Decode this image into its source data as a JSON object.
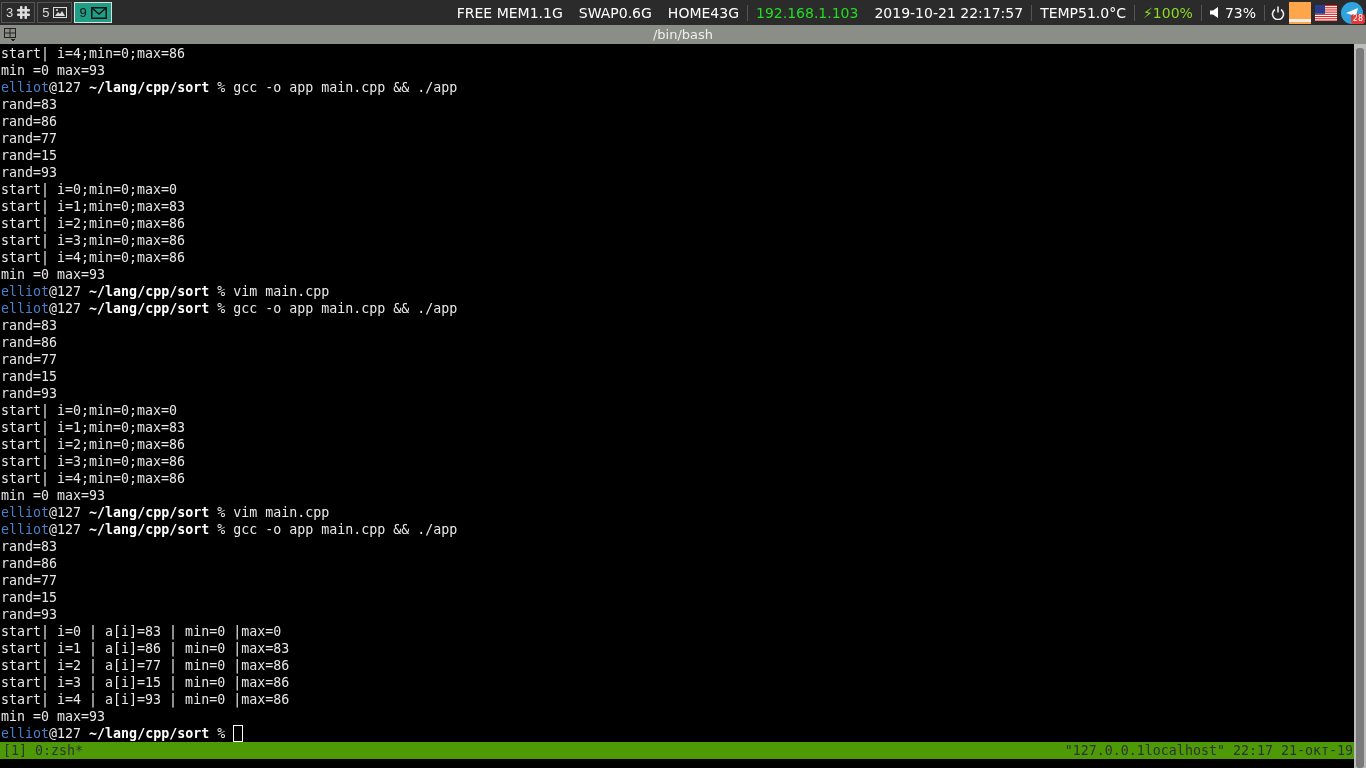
{
  "workspaces": [
    {
      "number": "3",
      "selected": false
    },
    {
      "number": "5",
      "selected": false
    },
    {
      "number": "9",
      "selected": true
    }
  ],
  "status": [
    {
      "kind": "text",
      "text": "FREE MEM1.1G",
      "color": "#ffffff"
    },
    {
      "kind": "text",
      "text": "SWAP0.6G",
      "color": "#ffffff"
    },
    {
      "kind": "text",
      "text": "HOME43G",
      "color": "#ffffff"
    },
    {
      "kind": "text",
      "text": "192.168.1.103",
      "color": "#22dd22"
    },
    {
      "kind": "text",
      "text": "2019-10-21 22:17:57",
      "color": "#ffffff"
    },
    {
      "kind": "text",
      "text": "TEMP51.0°C",
      "color": "#ffffff"
    },
    {
      "kind": "text",
      "text": "⚡100%",
      "color": "#88dd22"
    },
    {
      "kind": "volume",
      "text": "73%",
      "color": "#ffffff"
    }
  ],
  "tray": {
    "badge": "28"
  },
  "window": {
    "title": "/bin/bash"
  },
  "terminal": {
    "lines": [
      {
        "kind": "output",
        "text": "start| i=4;min=0;max=86"
      },
      {
        "kind": "output",
        "text": "min =0 max=93"
      },
      {
        "kind": "prompt",
        "user": "elliot",
        "host": "@127",
        "path": "~/lang/cpp/sort",
        "command": "% gcc -o app main.cpp && ./app"
      },
      {
        "kind": "output",
        "text": "rand=83"
      },
      {
        "kind": "output",
        "text": "rand=86"
      },
      {
        "kind": "output",
        "text": "rand=77"
      },
      {
        "kind": "output",
        "text": "rand=15"
      },
      {
        "kind": "output",
        "text": "rand=93"
      },
      {
        "kind": "output",
        "text": "start| i=0;min=0;max=0"
      },
      {
        "kind": "output",
        "text": "start| i=1;min=0;max=83"
      },
      {
        "kind": "output",
        "text": "start| i=2;min=0;max=86"
      },
      {
        "kind": "output",
        "text": "start| i=3;min=0;max=86"
      },
      {
        "kind": "output",
        "text": "start| i=4;min=0;max=86"
      },
      {
        "kind": "output",
        "text": "min =0 max=93"
      },
      {
        "kind": "prompt",
        "user": "elliot",
        "host": "@127",
        "path": "~/lang/cpp/sort",
        "command": "% vim main.cpp"
      },
      {
        "kind": "prompt",
        "user": "elliot",
        "host": "@127",
        "path": "~/lang/cpp/sort",
        "command": "% gcc -o app main.cpp && ./app"
      },
      {
        "kind": "output",
        "text": "rand=83"
      },
      {
        "kind": "output",
        "text": "rand=86"
      },
      {
        "kind": "output",
        "text": "rand=77"
      },
      {
        "kind": "output",
        "text": "rand=15"
      },
      {
        "kind": "output",
        "text": "rand=93"
      },
      {
        "kind": "output",
        "text": "start| i=0;min=0;max=0"
      },
      {
        "kind": "output",
        "text": "start| i=1;min=0;max=83"
      },
      {
        "kind": "output",
        "text": "start| i=2;min=0;max=86"
      },
      {
        "kind": "output",
        "text": "start| i=3;min=0;max=86"
      },
      {
        "kind": "output",
        "text": "start| i=4;min=0;max=86"
      },
      {
        "kind": "output",
        "text": "min =0 max=93"
      },
      {
        "kind": "prompt",
        "user": "elliot",
        "host": "@127",
        "path": "~/lang/cpp/sort",
        "command": "% vim main.cpp"
      },
      {
        "kind": "prompt",
        "user": "elliot",
        "host": "@127",
        "path": "~/lang/cpp/sort",
        "command": "% gcc -o app main.cpp && ./app"
      },
      {
        "kind": "output",
        "text": "rand=83"
      },
      {
        "kind": "output",
        "text": "rand=86"
      },
      {
        "kind": "output",
        "text": "rand=77"
      },
      {
        "kind": "output",
        "text": "rand=15"
      },
      {
        "kind": "output",
        "text": "rand=93"
      },
      {
        "kind": "output",
        "text": "start| i=0 | a[i]=83 | min=0 |max=0"
      },
      {
        "kind": "output",
        "text": "start| i=1 | a[i]=86 | min=0 |max=83"
      },
      {
        "kind": "output",
        "text": "start| i=2 | a[i]=77 | min=0 |max=86"
      },
      {
        "kind": "output",
        "text": "start| i=3 | a[i]=15 | min=0 |max=86"
      },
      {
        "kind": "output",
        "text": "start| i=4 | a[i]=93 | min=0 |max=86"
      },
      {
        "kind": "output",
        "text": "min =0 max=93"
      },
      {
        "kind": "prompt",
        "user": "elliot",
        "host": "@127",
        "path": "~/lang/cpp/sort",
        "command": "%",
        "cursor": true
      }
    ]
  },
  "tmux": {
    "session": "[1]",
    "window": "0:zsh*",
    "right": "\"127.0.0.1localhost\" 22:17 21-окт-19"
  }
}
